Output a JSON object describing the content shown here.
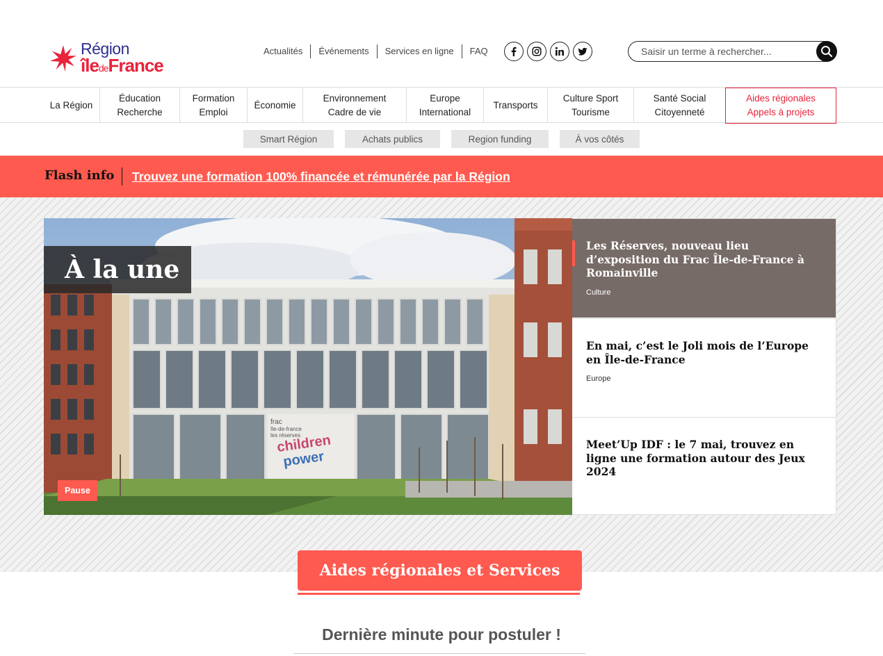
{
  "logo": {
    "line1": "Région",
    "line2_a": "île",
    "line2_b": "de",
    "line2_c": "France"
  },
  "toplinks": [
    "Actualités",
    "Événements",
    "Services en ligne",
    "FAQ"
  ],
  "socials": [
    "facebook-icon",
    "instagram-icon",
    "linkedin-icon",
    "twitter-icon"
  ],
  "search": {
    "placeholder": "Saisir un terme à rechercher..."
  },
  "mainnav": [
    {
      "l1": "La Région",
      "l2": ""
    },
    {
      "l1": "Éducation",
      "l2": "Recherche"
    },
    {
      "l1": "Formation",
      "l2": "Emploi"
    },
    {
      "l1": "Économie",
      "l2": ""
    },
    {
      "l1": "Environnement",
      "l2": "Cadre de vie"
    },
    {
      "l1": "Europe",
      "l2": "International"
    },
    {
      "l1": "Transports",
      "l2": ""
    },
    {
      "l1": "Culture Sport",
      "l2": "Tourisme"
    },
    {
      "l1": "Santé Social",
      "l2": "Citoyenneté"
    },
    {
      "l1": "Aides régionales",
      "l2": "Appels à projets"
    }
  ],
  "subnav": [
    "Smart Région",
    "Achats publics",
    "Region funding",
    "À vos côtés"
  ],
  "flash": {
    "label": "Flash info",
    "link": "Trouvez une formation 100% financée et rémunérée par la Région"
  },
  "hero": {
    "title": "À la une",
    "pause": "Pause",
    "stories": [
      {
        "title": "Les Réserves, nouveau lieu d’exposition du Frac Île-de-France à Romainville",
        "category": "Culture"
      },
      {
        "title": "En mai, c’est le Joli mois de l’Europe en Île-de-France",
        "category": "Europe"
      },
      {
        "title": "Meet’Up IDF : le 7 mai, trouvez en ligne une formation autour des Jeux 2024",
        "category": ""
      }
    ],
    "building_sign": [
      "frac",
      "île-de-france",
      "les réserves",
      "children",
      "power"
    ]
  },
  "services": {
    "title": "Aides régionales et Services"
  },
  "lastminute": {
    "title": "Dernière minute pour postuler !"
  },
  "colors": {
    "accent": "#ff5a4f",
    "brand_blue": "#2d2f8e",
    "brand_red": "#e8233b",
    "active_story": "#776b67"
  }
}
